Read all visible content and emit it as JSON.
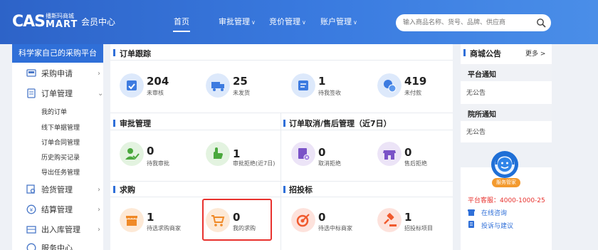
{
  "header": {
    "logo_main": "CAS",
    "logo_cn": "播斯玛商城",
    "logo_sub": "MART",
    "member_center": "会员中心",
    "nav": [
      "首页",
      "审批管理",
      "竞价管理",
      "账户管理"
    ],
    "search_placeholder": "输入商品名称、货号、品牌、供应商"
  },
  "sidebar": {
    "title": "科学家自己的采购平台",
    "items": [
      "采购申请",
      "订单管理",
      "验货管理",
      "结算管理",
      "出入库管理",
      "服务中心"
    ],
    "sub_items": [
      "我的订单",
      "线下单据管理",
      "订单合同管理",
      "历史购买记录",
      "导出任务管理"
    ]
  },
  "order_tracking": {
    "title": "订单跟踪",
    "stats": [
      {
        "num": "204",
        "label": "未审核"
      },
      {
        "num": "25",
        "label": "未发货"
      },
      {
        "num": "1",
        "label": "待我签收"
      },
      {
        "num": "419",
        "label": "未付款"
      }
    ]
  },
  "approval": {
    "title": "审批管理",
    "stats": [
      {
        "num": "0",
        "label": "待我审批"
      },
      {
        "num": "1",
        "label": "审批拒绝(近7日)"
      }
    ]
  },
  "cancel": {
    "title": "订单取消/售后管理（近7日）",
    "stats": [
      {
        "num": "0",
        "label": "取消拒绝"
      },
      {
        "num": "0",
        "label": "售后拒绝"
      }
    ]
  },
  "purchase": {
    "title": "求购",
    "stats": [
      {
        "num": "1",
        "label": "待选求购商家"
      },
      {
        "num": "0",
        "label": "我的求购"
      }
    ]
  },
  "bidding": {
    "title": "招投标",
    "stats": [
      {
        "num": "0",
        "label": "待选中标商家"
      },
      {
        "num": "1",
        "label": "招投标项目"
      }
    ]
  },
  "notice": {
    "title": "商城公告",
    "more": "更多 >",
    "platform": "平台通知",
    "platform_none": "无公告",
    "school": "院所通知",
    "school_none": "无公告"
  },
  "service": {
    "badge": "服务管家",
    "hotline": "平台客服：4000-1000-25",
    "online": "在线咨询",
    "complaint": "投诉与建议"
  },
  "colors": {
    "header": "#3a7be0",
    "accent": "#2f6fd8",
    "highlight": "#e8322e",
    "hotline": "#e8322e"
  }
}
